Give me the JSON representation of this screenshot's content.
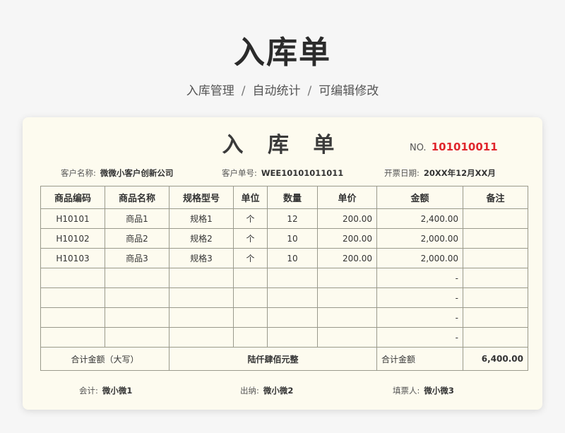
{
  "hero": {
    "title": "入库单",
    "subtitle_parts": [
      "入库管理",
      "自动统计",
      "可编辑修改"
    ],
    "separator": "/"
  },
  "form": {
    "title": "入 库 单",
    "no_label": "NO.",
    "no_value": "101010011",
    "customer_name_label": "客户名称:",
    "customer_name": "微微小客户创新公司",
    "customer_order_label": "客户单号:",
    "customer_order": "WEE10101011011",
    "date_label": "开票日期:",
    "date": "20XX年12月XX月"
  },
  "table": {
    "headers": [
      "商品编码",
      "商品名称",
      "规格型号",
      "单位",
      "数量",
      "单价",
      "金额",
      "备注"
    ],
    "rows": [
      [
        "H10101",
        "商品1",
        "规格1",
        "个",
        "12",
        "200.00",
        "2,400.00",
        ""
      ],
      [
        "H10102",
        "商品2",
        "规格2",
        "个",
        "10",
        "200.00",
        "2,000.00",
        ""
      ],
      [
        "H10103",
        "商品3",
        "规格3",
        "个",
        "10",
        "200.00",
        "2,000.00",
        ""
      ],
      [
        "",
        "",
        "",
        "",
        "",
        "",
        "-",
        ""
      ],
      [
        "",
        "",
        "",
        "",
        "",
        "",
        "-",
        ""
      ],
      [
        "",
        "",
        "",
        "",
        "",
        "",
        "-",
        ""
      ],
      [
        "",
        "",
        "",
        "",
        "",
        "",
        "-",
        ""
      ]
    ],
    "total_upper_label": "合计金额（大写）",
    "total_upper_value": "陆仟肆佰元整",
    "total_label": "合计金额",
    "total_value": "6,400.00"
  },
  "signatures": {
    "accountant_label": "会计:",
    "accountant": "微小微1",
    "cashier_label": "出纳:",
    "cashier": "微小微2",
    "issuer_label": "填票人:",
    "issuer": "微小微3"
  }
}
